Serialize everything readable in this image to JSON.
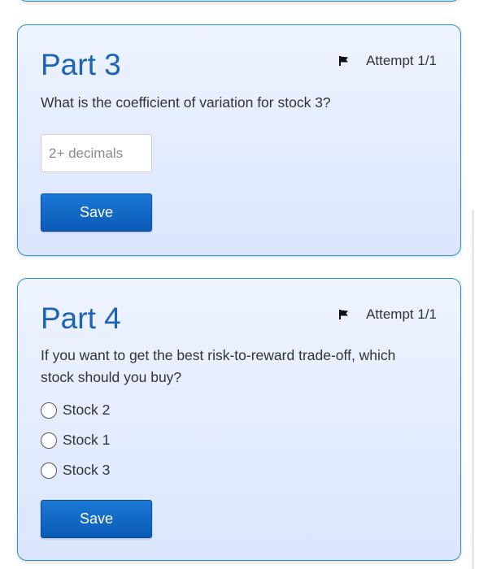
{
  "part3": {
    "title": "Part 3",
    "attempt": "Attempt 1/1",
    "question": "What is the coefficient of variation for stock 3?",
    "input_placeholder": "2+ decimals",
    "input_value": "",
    "save_label": "Save"
  },
  "part4": {
    "title": "Part 4",
    "attempt": "Attempt 1/1",
    "question": "If you want to get the best risk-to-reward trade-off, which stock should you buy?",
    "options": [
      {
        "label": "Stock 2",
        "selected": false
      },
      {
        "label": "Stock 1",
        "selected": false
      },
      {
        "label": "Stock 3",
        "selected": false
      }
    ],
    "save_label": "Save"
  },
  "icons": {
    "flag": "flag-icon",
    "radio": "radio-button-icon"
  },
  "colors": {
    "accent": "#1a63b8",
    "button": "#0a5bb5",
    "card_border": "#2b8fcf",
    "card_background": "#e4ecfe"
  }
}
